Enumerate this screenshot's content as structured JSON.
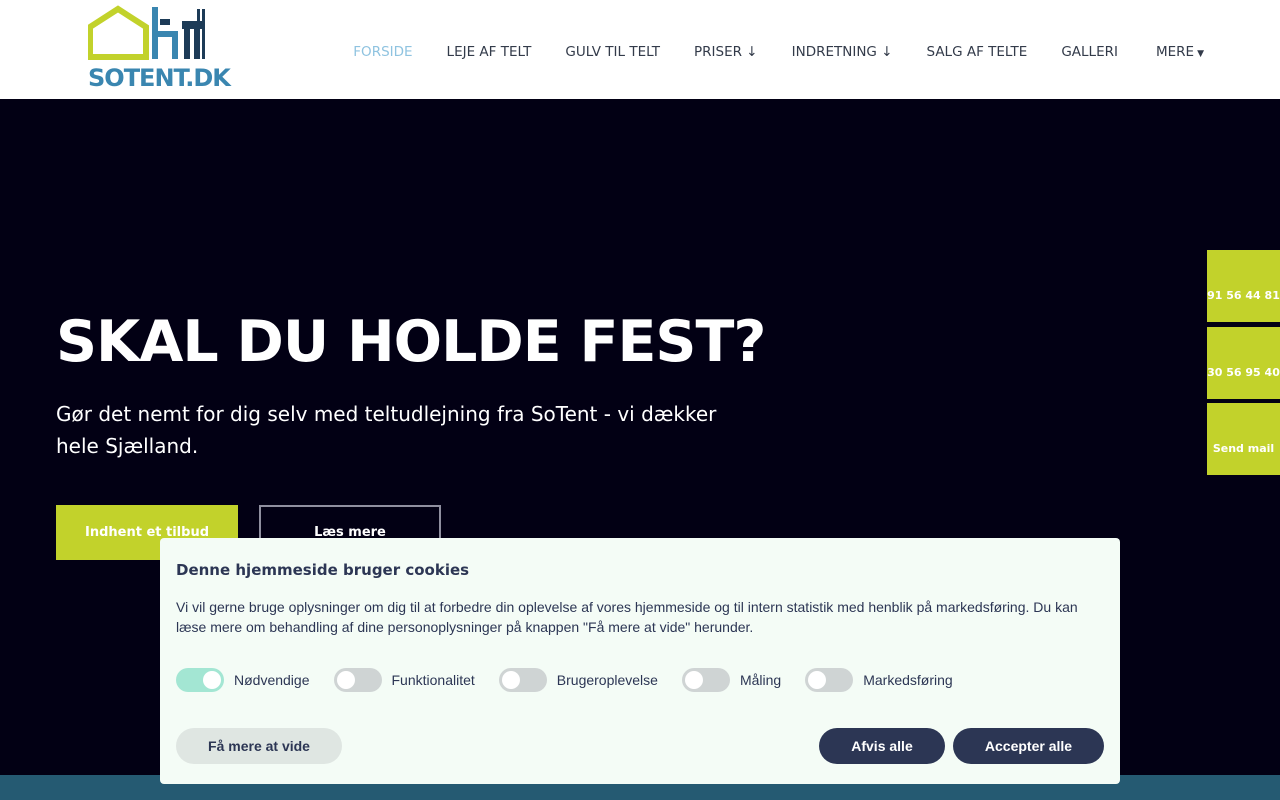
{
  "header": {
    "logo_text": "SOTENT.DK",
    "logo_icon": "tent-furniture-logo-icon",
    "nav": {
      "items": [
        {
          "label": "FORSIDE",
          "active": true
        },
        {
          "label": "LEJE AF TELT"
        },
        {
          "label": "GULV TIL TELT"
        },
        {
          "label": "PRISER ↓"
        },
        {
          "label": "INDRETNING ↓"
        },
        {
          "label": "SALG AF TELTE"
        },
        {
          "label": "GALLERI"
        }
      ],
      "more_label": "MERE",
      "more_icon": "caret-down-icon"
    }
  },
  "hero": {
    "title": "SKAL DU HOLDE FEST?",
    "text": "Gør det nemt for dig selv med teltudlejning fra SoTent - vi dækker hele Sjælland.",
    "primary_button": "Indhent et tilbud",
    "secondary_button": "Læs mere"
  },
  "side_contacts": {
    "phone_1": "91 56 44 81",
    "phone_2": "30 56 95 40",
    "mail": "Send mail"
  },
  "cookie": {
    "title": "Denne hjemmeside bruger cookies",
    "text": "Vi vil gerne bruge oplysninger om dig til at forbedre din oplevelse af vores hjemmeside og til intern statistik med henblik på markedsføring. Du kan læse mere om behandling af dine personoplysninger på knappen \"Få mere at vide\" herunder.",
    "toggles": [
      {
        "label": "Nødvendige",
        "on": true
      },
      {
        "label": "Funktionalitet",
        "on": false
      },
      {
        "label": "Brugeroplevelse",
        "on": false
      },
      {
        "label": "Måling",
        "on": false
      },
      {
        "label": "Markedsføring",
        "on": false
      }
    ],
    "more_button": "Få mere at vide",
    "reject_button": "Afvis alle",
    "accept_button": "Accepter alle"
  },
  "colors": {
    "accent_green": "#c2d22b",
    "logo_blue": "#3a86b0",
    "hero_bg": "#020014",
    "cookie_button": "#2c3654",
    "toggle_on": "#a3e6d3"
  }
}
